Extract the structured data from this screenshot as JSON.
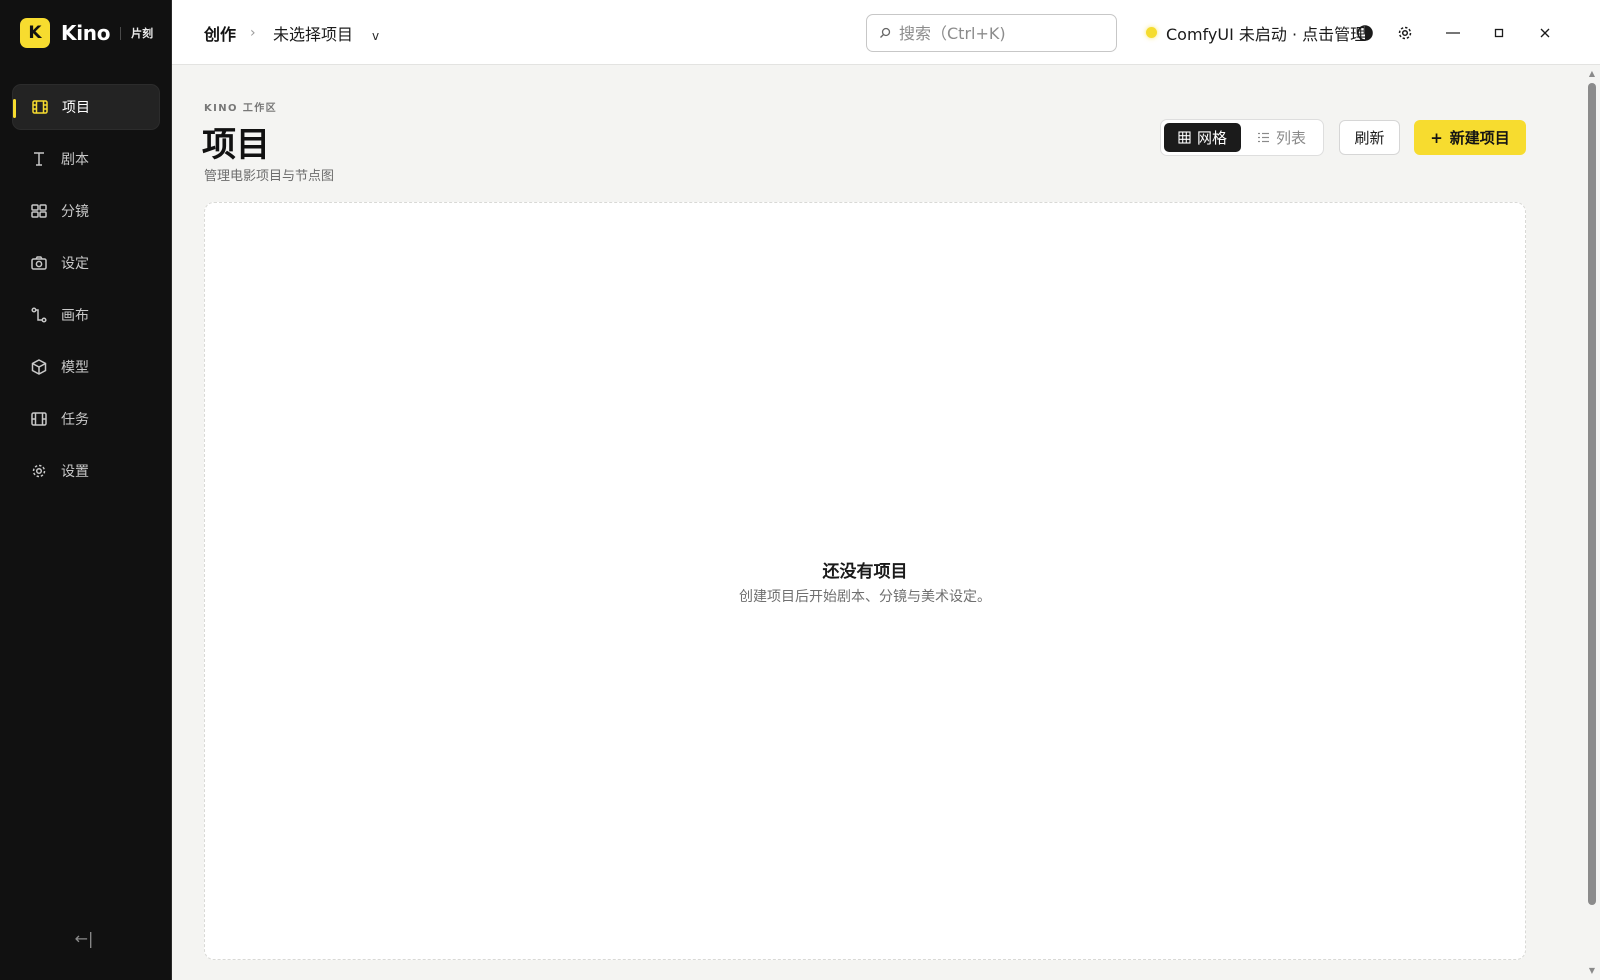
{
  "brand": {
    "logo_letter": "K",
    "name": "Kino",
    "subtitle": "片刻"
  },
  "sidebar": {
    "items": [
      {
        "label": "项目",
        "icon": "film-icon",
        "active": true
      },
      {
        "label": "剧本",
        "icon": "text-cursor-icon",
        "active": false
      },
      {
        "label": "分镜",
        "icon": "grid-icon",
        "active": false
      },
      {
        "label": "设定",
        "icon": "camera-icon",
        "active": false
      },
      {
        "label": "画布",
        "icon": "node-graph-icon",
        "active": false
      },
      {
        "label": "模型",
        "icon": "cube-icon",
        "active": false
      },
      {
        "label": "任务",
        "icon": "film-strip-icon",
        "active": false
      },
      {
        "label": "设置",
        "icon": "gear-icon",
        "active": false
      }
    ],
    "collapse_label": "←|"
  },
  "topbar": {
    "breadcrumb_root": "创作",
    "breadcrumb_sep": "›",
    "breadcrumb_project": "未选择项目",
    "breadcrumb_chevron": "v",
    "search_placeholder": "搜索（Ctrl+K)",
    "comfy_status": "ComfyUI 未启动 · 点击管理",
    "icons": [
      "theme-toggle-icon",
      "settings-icon",
      "minimize-icon",
      "maximize-icon",
      "close-icon"
    ]
  },
  "main": {
    "eyebrow": "KINO 工作区",
    "title": "项目",
    "subtitle": "管理电影项目与节点图",
    "view_toggle": {
      "grid_label": "网格",
      "list_label": "列表",
      "selected": "grid"
    },
    "refresh_label": "刷新",
    "new_project_label": "新建项目",
    "new_project_plus": "+",
    "empty": {
      "title": "还没有项目",
      "description": "创建项目后开始剧本、分镜与美术设定。"
    }
  },
  "colors": {
    "accent": "#f7dc2f",
    "sidebar_bg": "#111111",
    "main_bg": "#f4f4f2"
  }
}
